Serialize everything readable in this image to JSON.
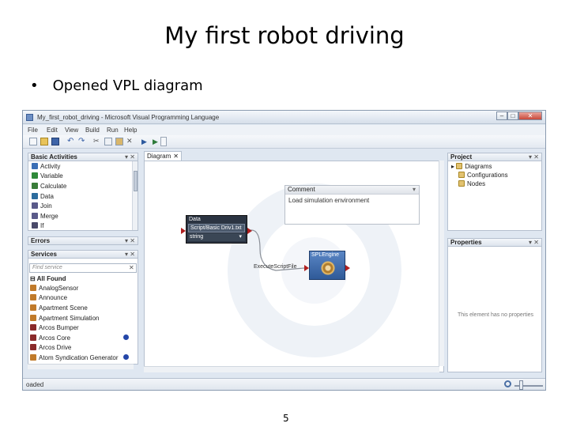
{
  "slide": {
    "title": "My first robot driving",
    "bullet": "Opened VPL diagram",
    "page_number": "5"
  },
  "app": {
    "window_title": "My_first_robot_driving - Microsoft Visual Programming Language",
    "window_controls": {
      "minimize": "‒",
      "maximize": "□",
      "close": "✕"
    },
    "menu": [
      "File",
      "Edit",
      "View",
      "Build",
      "Run",
      "Help"
    ],
    "toolbar_icons": [
      "new-icon",
      "open-icon",
      "save-icon",
      "undo-icon",
      "redo-icon",
      "cut-icon",
      "copy-icon",
      "paste-icon",
      "delete-icon",
      "run-icon",
      "debug-icon"
    ],
    "basic_activities": {
      "header": "Basic Activities",
      "ctrl": "▾ ✕",
      "items": [
        {
          "label": "Activity",
          "icon": "activity-icon",
          "color": "#3b6fb6"
        },
        {
          "label": "Variable",
          "icon": "variable-icon",
          "color": "#2f8a3a"
        },
        {
          "label": "Calculate",
          "icon": "calculate-icon",
          "color": "#3a7d3a"
        },
        {
          "label": "Data",
          "icon": "data-icon",
          "color": "#2c6c9e"
        },
        {
          "label": "Join",
          "icon": "join-icon",
          "color": "#5a5a8a"
        },
        {
          "label": "Merge",
          "icon": "merge-icon",
          "color": "#5a5a8a"
        },
        {
          "label": "If",
          "icon": "if-icon",
          "color": "#4a4a6a"
        }
      ]
    },
    "errors": {
      "header": "Errors",
      "ctrl": "▾ ✕"
    },
    "services": {
      "header": "Services",
      "ctrl": "▾ ✕",
      "search_placeholder": "Find service",
      "search_clear": "✕",
      "group_label": "All Found",
      "items": [
        {
          "label": "AnalogSensor",
          "icon": "sensor-icon",
          "color": "#c07a2a",
          "info": false
        },
        {
          "label": "Announce",
          "icon": "announce-icon",
          "color": "#c07a2a",
          "info": false
        },
        {
          "label": "Apartment Scene",
          "icon": "scene-icon",
          "color": "#c07a2a",
          "info": false
        },
        {
          "label": "Apartment Simulation",
          "icon": "simulation-icon",
          "color": "#c07a2a",
          "info": false
        },
        {
          "label": "Arcos Bumper",
          "icon": "bumper-icon",
          "color": "#8a2a2a",
          "info": false
        },
        {
          "label": "Arcos Core",
          "icon": "robot-icon",
          "color": "#8a2a2a",
          "info": true
        },
        {
          "label": "Arcos Drive",
          "icon": "robot-icon",
          "color": "#8a2a2a",
          "info": false
        },
        {
          "label": "Atom Syndication Generator",
          "icon": "atom-icon",
          "color": "#c07a2a",
          "info": true
        }
      ]
    },
    "diagram_tab": {
      "label": "Diagram",
      "close": "✕"
    },
    "comment": {
      "header": "Comment",
      "ctrl": "▾",
      "text": "Load simulation environment"
    },
    "data_node": {
      "title": "Data",
      "value": "Script/Basic Driv1.txt",
      "type": "string",
      "type_arrow": "▾"
    },
    "connection_label": "ExecuteScriptFile",
    "spl_node": {
      "title": "SPLEngine"
    },
    "project": {
      "header": "Project",
      "ctrl": "▾ ✕",
      "items": [
        {
          "label": "Diagrams",
          "icon": "folder-icon"
        },
        {
          "label": "Configurations",
          "icon": "folder-icon"
        },
        {
          "label": "Nodes",
          "icon": "folder-icon"
        }
      ]
    },
    "properties": {
      "header": "Properties",
      "ctrl": "▾ ✕",
      "empty_text": "This element has no properties"
    },
    "status": "oaded"
  }
}
